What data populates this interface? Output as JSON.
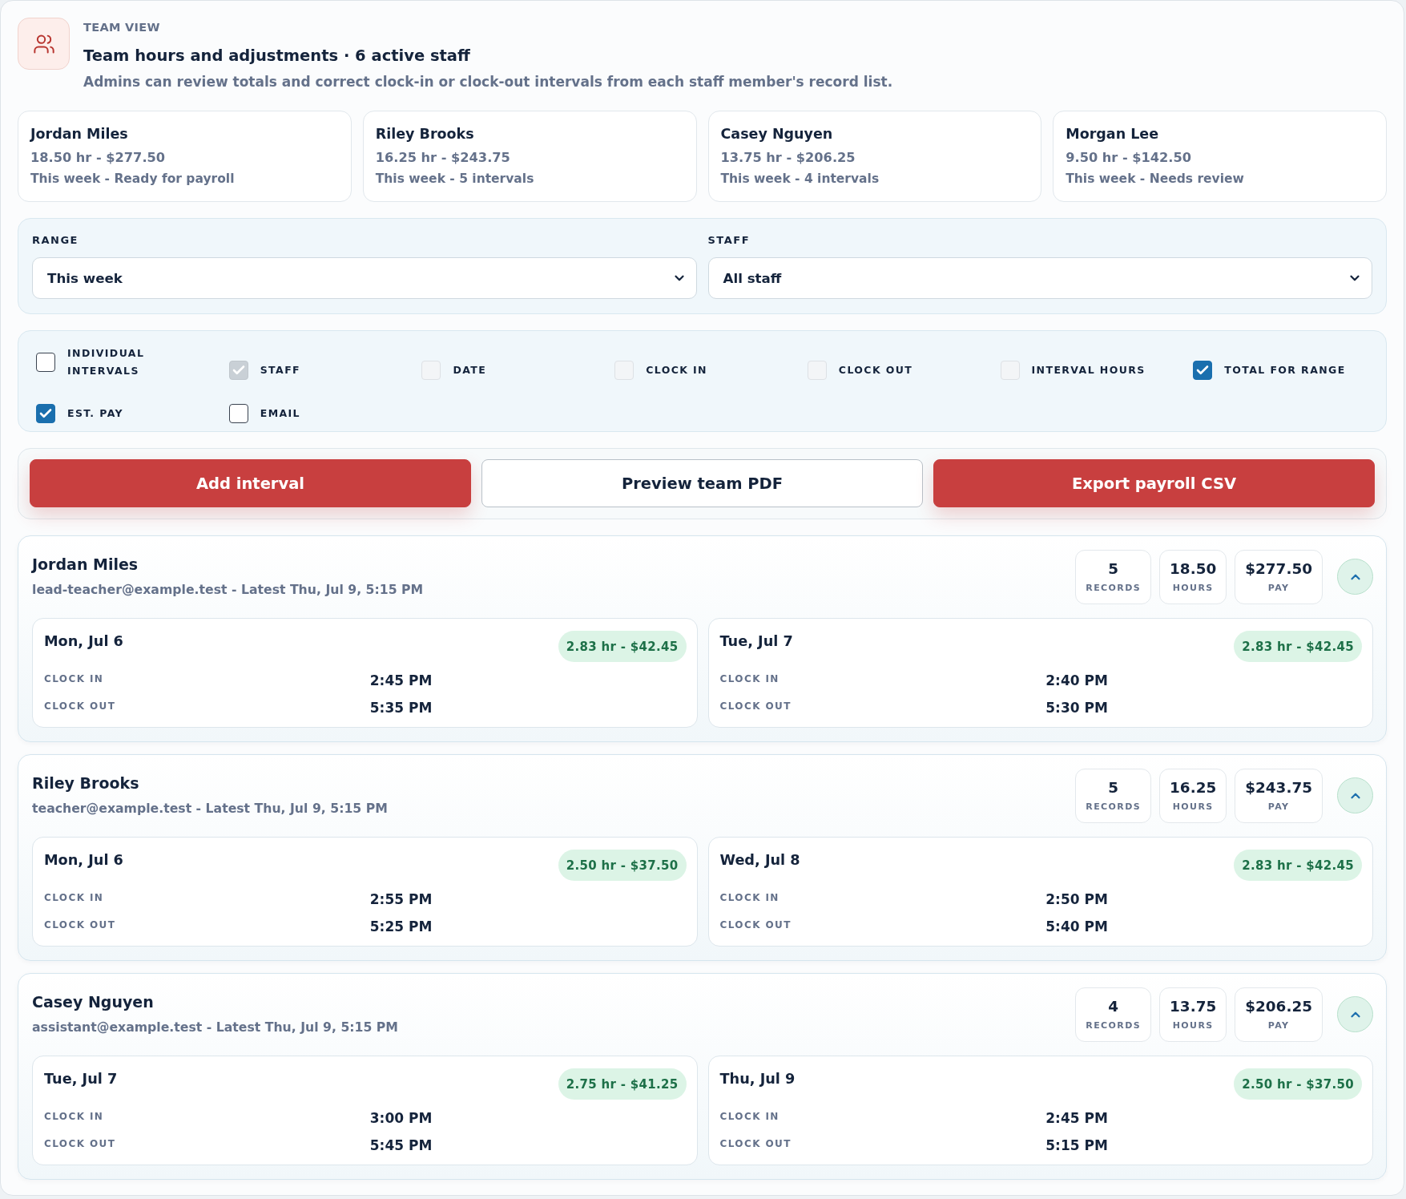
{
  "header": {
    "eyebrow": "TEAM VIEW",
    "title": "Team hours and adjustments · 6 active staff",
    "subtitle": "Admins can review totals and correct clock-in or clock-out intervals from each staff member's record list."
  },
  "summary_cards": [
    {
      "name": "Jordan Miles",
      "totals": "18.50 hr - $277.50",
      "status": "This week - Ready for payroll"
    },
    {
      "name": "Riley Brooks",
      "totals": "16.25 hr - $243.75",
      "status": "This week - 5 intervals"
    },
    {
      "name": "Casey Nguyen",
      "totals": "13.75 hr - $206.25",
      "status": "This week - 4 intervals"
    },
    {
      "name": "Morgan Lee",
      "totals": "9.50 hr - $142.50",
      "status": "This week - Needs review"
    }
  ],
  "filters": [
    {
      "label": "RANGE",
      "value": "This week"
    },
    {
      "label": "STAFF",
      "value": "All staff"
    }
  ],
  "columns": [
    {
      "label": "INDIVIDUAL INTERVALS",
      "checked": false,
      "disabled": false
    },
    {
      "label": "STAFF",
      "checked": true,
      "disabled": true
    },
    {
      "label": "DATE",
      "checked": false,
      "disabled": true
    },
    {
      "label": "CLOCK IN",
      "checked": false,
      "disabled": true
    },
    {
      "label": "CLOCK OUT",
      "checked": false,
      "disabled": true
    },
    {
      "label": "INTERVAL HOURS",
      "checked": false,
      "disabled": true
    },
    {
      "label": "TOTAL FOR RANGE",
      "checked": true,
      "disabled": false
    },
    {
      "label": "EST. PAY",
      "checked": true,
      "disabled": false
    },
    {
      "label": "EMAIL",
      "checked": false,
      "disabled": false
    }
  ],
  "actions": [
    {
      "label": "Add interval",
      "kind": "primary"
    },
    {
      "label": "Preview team PDF",
      "kind": "secondary"
    },
    {
      "label": "Export payroll CSV",
      "kind": "primary"
    }
  ],
  "staff": [
    {
      "name": "Jordan Miles",
      "meta": "lead-teacher@example.test - Latest Thu, Jul 9, 5:15 PM",
      "expanded": true,
      "stats": [
        {
          "value": "5",
          "label": "RECORDS"
        },
        {
          "value": "18.50",
          "label": "HOURS"
        },
        {
          "value": "$277.50",
          "label": "PAY"
        }
      ],
      "intervals": [
        {
          "date": "Mon, Jul 6",
          "badge": "2.83 hr - $42.45",
          "rows": [
            {
              "label": "CLOCK IN",
              "value": "2:45 PM"
            },
            {
              "label": "CLOCK OUT",
              "value": "5:35 PM"
            }
          ]
        },
        {
          "date": "Tue, Jul 7",
          "badge": "2.83 hr - $42.45",
          "rows": [
            {
              "label": "CLOCK IN",
              "value": "2:40 PM"
            },
            {
              "label": "CLOCK OUT",
              "value": "5:30 PM"
            }
          ]
        }
      ]
    },
    {
      "name": "Riley Brooks",
      "meta": "teacher@example.test - Latest Thu, Jul 9, 5:15 PM",
      "expanded": true,
      "stats": [
        {
          "value": "5",
          "label": "RECORDS"
        },
        {
          "value": "16.25",
          "label": "HOURS"
        },
        {
          "value": "$243.75",
          "label": "PAY"
        }
      ],
      "intervals": [
        {
          "date": "Mon, Jul 6",
          "badge": "2.50 hr - $37.50",
          "rows": [
            {
              "label": "CLOCK IN",
              "value": "2:55 PM"
            },
            {
              "label": "CLOCK OUT",
              "value": "5:25 PM"
            }
          ]
        },
        {
          "date": "Wed, Jul 8",
          "badge": "2.83 hr - $42.45",
          "rows": [
            {
              "label": "CLOCK IN",
              "value": "2:50 PM"
            },
            {
              "label": "CLOCK OUT",
              "value": "5:40 PM"
            }
          ]
        }
      ]
    },
    {
      "name": "Casey Nguyen",
      "meta": "assistant@example.test - Latest Thu, Jul 9, 5:15 PM",
      "expanded": true,
      "stats": [
        {
          "value": "4",
          "label": "RECORDS"
        },
        {
          "value": "13.75",
          "label": "HOURS"
        },
        {
          "value": "$206.25",
          "label": "PAY"
        }
      ],
      "intervals": [
        {
          "date": "Tue, Jul 7",
          "badge": "2.75 hr - $41.25",
          "rows": [
            {
              "label": "CLOCK IN",
              "value": "3:00 PM"
            },
            {
              "label": "CLOCK OUT",
              "value": "5:45 PM"
            }
          ]
        },
        {
          "date": "Thu, Jul 9",
          "badge": "2.50 hr - $37.50",
          "rows": [
            {
              "label": "CLOCK IN",
              "value": "2:45 PM"
            },
            {
              "label": "CLOCK OUT",
              "value": "5:15 PM"
            }
          ]
        }
      ]
    }
  ]
}
